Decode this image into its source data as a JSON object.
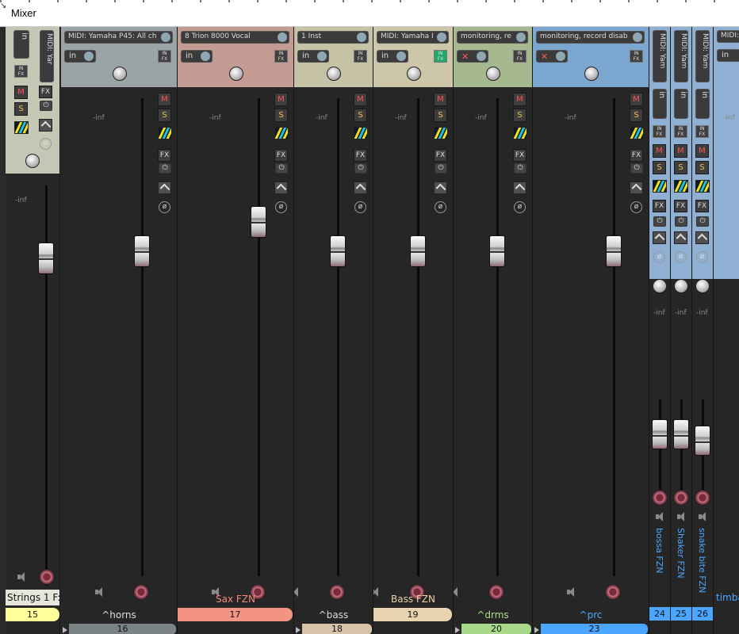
{
  "window": {
    "title": "Mixer"
  },
  "inf_label": "-inf",
  "buttons": {
    "mute": "M",
    "solo": "S",
    "fx": "FX",
    "infx_top": "IN",
    "infx_bottom": "FX",
    "input": "in",
    "phase": "ø"
  },
  "strips": [
    {
      "id": "s15",
      "header_color": "#c5c6b4",
      "io": "MIDI: Yar",
      "vertical_io": true,
      "name": "Strings 1 F:",
      "number": "15",
      "number_color": "#ffff99",
      "name_color": "#111",
      "fader_level": 0.55
    },
    {
      "id": "s16",
      "header_color": "#9aa3a6",
      "io": "MIDI: Yamaha P45: All ch",
      "name": "^horns",
      "name_color": "#dddddd",
      "folder_number": "16",
      "folder_color": "#7b8387",
      "fader_level": 0.78
    },
    {
      "id": "s17",
      "header_color": "#c39b92",
      "io": "8 Trion 8000 Vocal",
      "name": "Sax FZN",
      "name_color": "#f28a7a",
      "number": "17",
      "number_color": "#f39384",
      "fader_level": 0.84
    },
    {
      "id": "s18",
      "header_color": "#c6c2a6",
      "io": "1 Inst",
      "name": "^bass",
      "name_color": "#dddddd",
      "folder_number": "18",
      "folder_color": "#d8c4a8",
      "fader_level": 0.78
    },
    {
      "id": "s19",
      "header_color": "#cdc6a8",
      "io": "MIDI: Yamaha I",
      "infx_active": true,
      "name": "Bass FZN",
      "name_color": "#e8d3a6",
      "number": "19",
      "number_color": "#e8d3ae",
      "fader_level": 0.78
    },
    {
      "id": "s20",
      "header_color": "#a6b98e",
      "io": "monitoring, re",
      "input_disabled": true,
      "name": "^drms",
      "name_color": "#a8e08a",
      "folder_number": "20",
      "folder_color": "#a8d98a",
      "fader_level": 0.78
    },
    {
      "id": "s23",
      "header_color": "#7aa6cf",
      "io": "monitoring, record disab",
      "input_disabled": true,
      "name": "^prc",
      "name_color": "#4ea8ff",
      "folder_number": "23",
      "folder_color": "#4aa6ff",
      "fader_level": 0.78
    },
    {
      "id": "s24",
      "header_color": "#8fb0d2",
      "io": "MIDI: Yam",
      "vertical_io": true,
      "name": "bossa FZN",
      "number": "24",
      "number_color": "#4aa6ff",
      "fader_level": 0.72
    },
    {
      "id": "s25",
      "header_color": "#8fb0d2",
      "io": "MIDI: Yam",
      "vertical_io": true,
      "name": "Shaker FZN",
      "number": "25",
      "number_color": "#4aa6ff",
      "fader_level": 0.72
    },
    {
      "id": "s26",
      "header_color": "#8fb0d2",
      "io": "MIDI: Yam",
      "vertical_io": true,
      "name": "snake bite FZN",
      "number": "26",
      "number_color": "#4aa6ff",
      "fader_level": 0.66
    },
    {
      "id": "s27",
      "header_color": "#8fb0d2",
      "io": "MIDI: Yam",
      "name": "timba",
      "name_color": "#4ea8ff"
    }
  ]
}
